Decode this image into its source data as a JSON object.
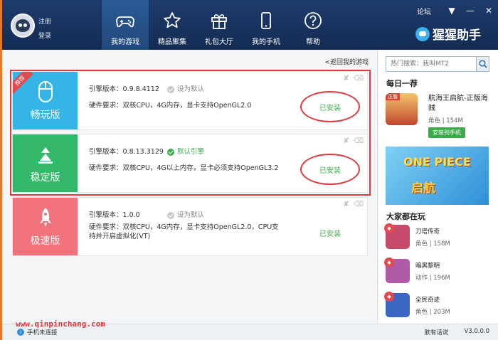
{
  "header": {
    "login": {
      "register": "注册",
      "login": "登录"
    },
    "nav": [
      {
        "label": "我的游戏",
        "icon": "gamepad-icon",
        "active": true
      },
      {
        "label": "精品聚集",
        "icon": "star-icon",
        "active": false
      },
      {
        "label": "礼包大厅",
        "icon": "gift-icon",
        "active": false
      },
      {
        "label": "我的手机",
        "icon": "phone-icon",
        "active": false
      },
      {
        "label": "帮助",
        "icon": "help-icon",
        "active": false
      }
    ],
    "forum": "论坛",
    "brand": "猩猩助手"
  },
  "main": {
    "back_link": "<返回我的游戏",
    "engines": [
      {
        "name": "畅玩版",
        "tag": "推荐",
        "color": "#35b4e6",
        "icon": "mouse-icon",
        "version": "引擎版本：0.9.8.4112",
        "default_label": "设为默认",
        "is_default": false,
        "requirement": "硬件要求：双核CPU，4G内存，显卡支持OpenGL2.0",
        "status": "已安装"
      },
      {
        "name": "稳定版",
        "color": "#33b86a",
        "icon": "triangle-icon",
        "version": "引擎版本：0.8.13.3129",
        "default_label": "默认引擎",
        "is_default": true,
        "requirement": "硬件要求：双核CPU，4G以上内存，显卡必须支持OpenGL3.2",
        "status": "已安装"
      },
      {
        "name": "极速版",
        "color": "#f2727c",
        "icon": "rocket-icon",
        "version": "引擎版本：1.0.0",
        "default_label": "设为默认",
        "is_default": false,
        "requirement": "硬件要求：双核CPU，4G内存，显卡支持OpenGL2.0，CPU支持并开启虚拟化(VT)",
        "status": "已安装"
      }
    ]
  },
  "sidebar": {
    "search_placeholder": "热门搜索：我叫MT2",
    "daily_title": "每日一荐",
    "daily": {
      "tag": "正版",
      "name": "航海王启航-正版海贼",
      "meta": "角色 | 154M",
      "button": "安装到手机"
    },
    "banner": {
      "title": "ONE PIECE",
      "subtitle": "启航"
    },
    "popular_title": "大家都在玩",
    "popular": [
      {
        "name": "刀塔传奇",
        "meta": "角色 | 158M",
        "color": "#c84a6a"
      },
      {
        "name": "暗黑黎明",
        "meta": "动作 | 196M",
        "color": "#b05aa8"
      },
      {
        "name": "全民奇迹",
        "meta": "角色 | 203M",
        "color": "#3b66c4"
      }
    ]
  },
  "footer": {
    "phone_status": "手机未连接",
    "skin": "肤有话说",
    "version": "V3.0.0.0"
  },
  "watermark": "www.qinpinchang.com"
}
